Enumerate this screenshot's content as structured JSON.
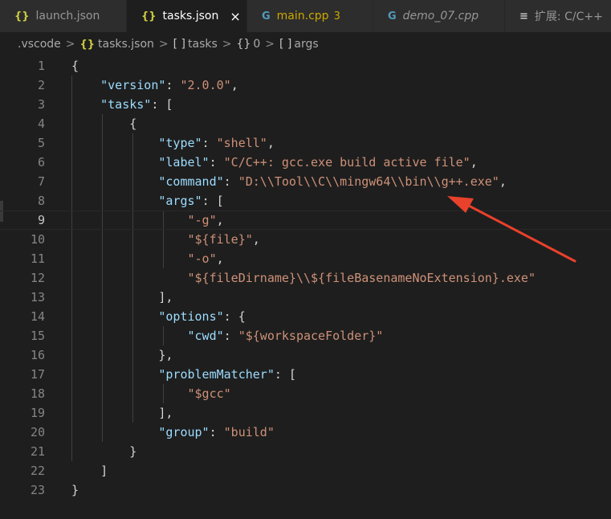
{
  "tabs": [
    {
      "icon": "{}",
      "label": "launch.json",
      "active": false
    },
    {
      "icon": "{}",
      "label": "tasks.json",
      "active": true,
      "close": "×"
    },
    {
      "icon": "G",
      "label": "main.cpp",
      "badge": "3"
    },
    {
      "icon": "G",
      "label": "demo_07.cpp"
    },
    {
      "icon": "≡",
      "label": "扩展: C/C++"
    }
  ],
  "breadcrumb": {
    "folder": ".vscode",
    "file_icon": "{}",
    "file": "tasks.json",
    "arr1_icon": "[ ]",
    "arr1": "tasks",
    "obj_icon": "{}",
    "obj": "0",
    "arr2_icon": "[ ]",
    "arr2": "args",
    "sep": ">"
  },
  "code": {
    "line_numbers": [
      "1",
      "2",
      "3",
      "4",
      "5",
      "6",
      "7",
      "8",
      "9",
      "10",
      "11",
      "12",
      "13",
      "14",
      "15",
      "16",
      "17",
      "18",
      "19",
      "20",
      "21",
      "22",
      "23"
    ],
    "version_key": "\"version\"",
    "version_val": "\"2.0.0\"",
    "tasks_key": "\"tasks\"",
    "type_key": "\"type\"",
    "type_val": "\"shell\"",
    "label_key": "\"label\"",
    "label_val": "\"C/C++: gcc.exe build active file\"",
    "command_key": "\"command\"",
    "command_val": "\"D:\\\\Tool\\\\C\\\\mingw64\\\\bin\\\\g++.exe\"",
    "args_key": "\"args\"",
    "arg1": "\"-g\"",
    "arg2": "\"${file}\"",
    "arg3": "\"-o\"",
    "arg4": "\"${fileDirname}\\\\${fileBasenameNoExtension}.exe\"",
    "options_key": "\"options\"",
    "cwd_key": "\"cwd\"",
    "cwd_val": "\"${workspaceFolder}\"",
    "pm_key": "\"problemMatcher\"",
    "pm_val": "\"$gcc\"",
    "group_key": "\"group\"",
    "group_val": "\"build\""
  },
  "colors": {
    "arrow": "#e8412c",
    "key": "#9cdcfe",
    "string": "#ce9178"
  }
}
